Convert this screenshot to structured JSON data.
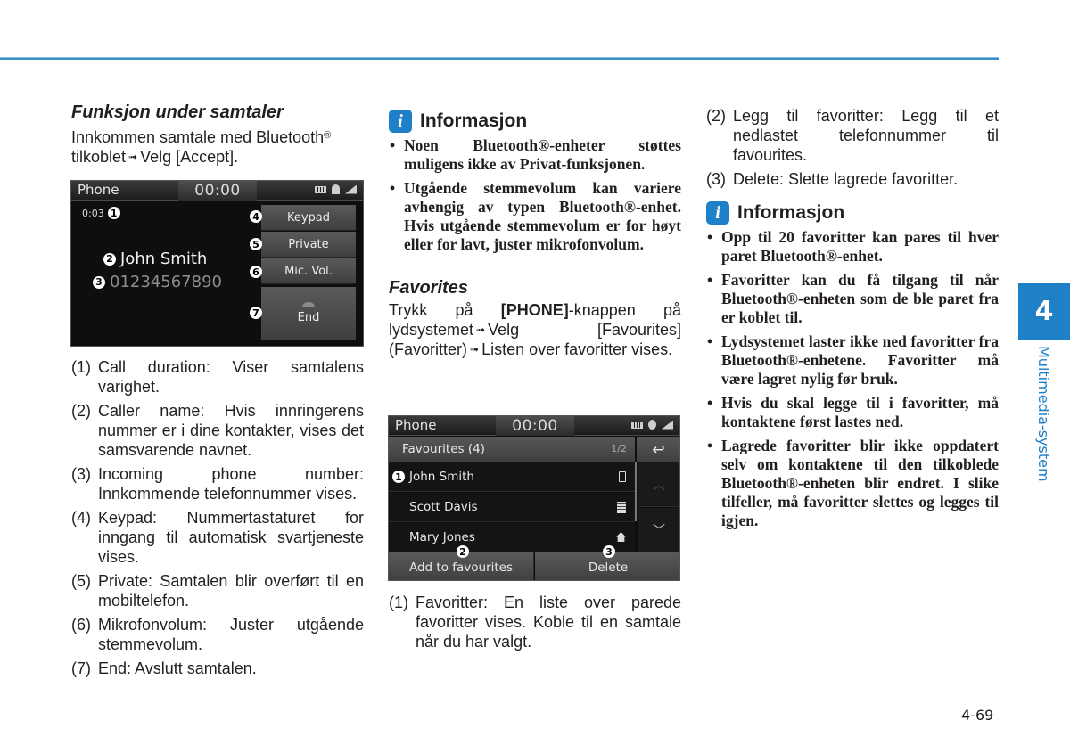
{
  "header": {
    "rule_color": "#3c8dc5"
  },
  "col1": {
    "title": "Funksjon under samtaler",
    "intro_a": "Innkommen samtale med Bluetooth",
    "intro_reg": "®",
    "intro_b": "tilkoblet",
    "intro_arrow": "➟",
    "intro_c": "Velg [Accept].",
    "call_screen": {
      "app_label": "Phone",
      "clock": "00:00",
      "status_icons": [
        "battery-icon",
        "bluetooth-icon",
        "signal-icon"
      ],
      "duration": "0:03",
      "caller_name": "John Smith",
      "caller_number": "01234567890",
      "buttons": [
        {
          "label": "Keypad",
          "badge": "4"
        },
        {
          "label": "Private",
          "badge": "5"
        },
        {
          "label": "Mic. Vol.",
          "badge": "6"
        },
        {
          "label": "End",
          "badge": "7"
        }
      ],
      "badges": {
        "duration": "1",
        "name": "2",
        "number": "3"
      }
    },
    "items": [
      {
        "n": "(1)",
        "text": "Call duration: Viser samtalens varighet."
      },
      {
        "n": "(2)",
        "text": "Caller name: Hvis innringerens nummer er i dine kontakter, vises det samsvarende navnet."
      },
      {
        "n": "(3)",
        "text": "Incoming phone number: Innkommende telefonnummer vises."
      },
      {
        "n": "(4)",
        "text": "Keypad: Nummertastaturet for inngang til automatisk svartjeneste vises."
      },
      {
        "n": "(5)",
        "text": "Private: Samtalen blir overført til en mobiltelefon."
      },
      {
        "n": "(6)",
        "text": "Mikrofonvolum: Juster utgående stemmevolum."
      },
      {
        "n": "(7)",
        "text": "End: Avslutt samtalen."
      }
    ]
  },
  "col2": {
    "info": {
      "icon": "i",
      "title": "Informasjon",
      "bullets": [
        "Noen Bluetooth®-enheter støttes muligens ikke av Privat-funksjonen.",
        "Utgående stemmevolum kan variere avhengig av typen Bluetooth®-enhet. Hvis utgående stemmevolum er for høyt eller for lavt, juster mikrofonvolum."
      ]
    },
    "fav_title": "Favorites",
    "fav_a": "Trykk på",
    "fav_bold": "[PHONE]",
    "fav_b": "-knappen på lydsystemet",
    "fav_arrow": "➟",
    "fav_c": "Velg [Favourites] (Favoritter)",
    "fav_d": "Listen over favoritter vises.",
    "fav_screen": {
      "app_label": "Phone",
      "clock": "00:00",
      "list_title": "Favourites (4)",
      "page": "1/2",
      "rows": [
        {
          "name": "John Smith",
          "type_icon": "mobile-icon"
        },
        {
          "name": "Scott Davis",
          "type_icon": "office-icon"
        },
        {
          "name": "Mary Jones",
          "type_icon": "home-icon"
        }
      ],
      "add_label": "Add to favourites",
      "delete_label": "Delete",
      "badges": {
        "list": "1",
        "add": "2",
        "delete": "3"
      }
    },
    "items": [
      {
        "n": "(1)",
        "text": "Favoritter: En liste over parede favoritter vises. Koble til en samtale når du har valgt."
      }
    ]
  },
  "col3": {
    "items": [
      {
        "n": "(2)",
        "text": "Legg til favoritter: Legg til et nedlastet telefonnummer til favourites."
      },
      {
        "n": "(3)",
        "text": "Delete: Slette lagrede favoritter."
      }
    ],
    "info": {
      "icon": "i",
      "title": "Informasjon",
      "bullets": [
        "Opp til 20 favoritter kan pares til hver paret Bluetooth®-enhet.",
        "Favoritter kan du få tilgang til når Bluetooth®-enheten som de ble paret fra er koblet til.",
        "Lydsystemet laster ikke ned favoritter fra Bluetooth®-enhetene. Favoritter må være lagret nylig før bruk.",
        "Hvis du skal legge til i favoritter, må kontaktene først lastes ned.",
        "Lagrede favoritter blir ikke oppdatert selv om kontaktene til den tilkoblede Bluetooth®-enheten blir endret. I slike tilfeller, må favoritter slettes og legges til igjen."
      ]
    }
  },
  "side_tab": {
    "chapter": "4",
    "label": "Multimedia-system",
    "color": "#1e80c6"
  },
  "footer": {
    "page_number": "4-69"
  }
}
